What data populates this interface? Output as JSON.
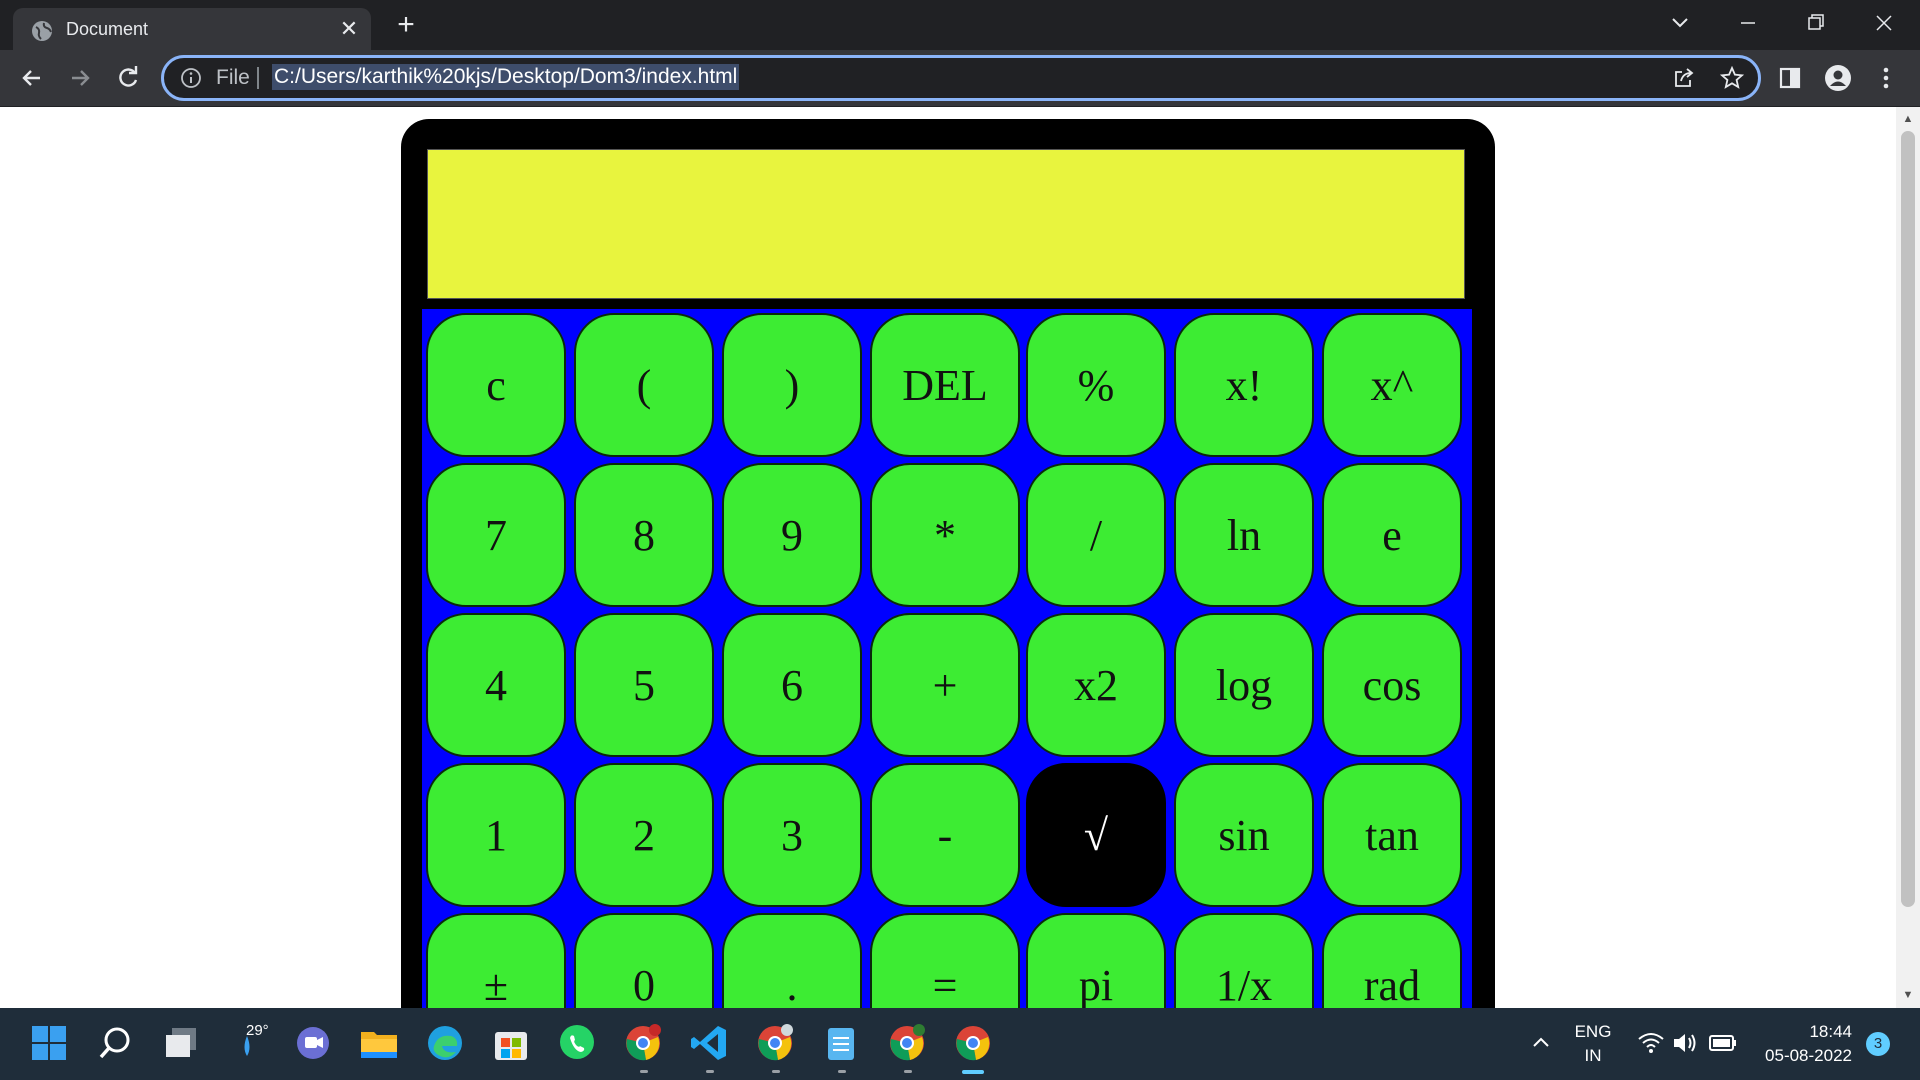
{
  "browser": {
    "tab_title": "Document",
    "new_tab_symbol": "+",
    "tab_close_symbol": "✕",
    "address_prefix": "File",
    "url": "C:/Users/karthik%20kjs/Desktop/Dom3/index.html",
    "accent_color": "#8ab4f8"
  },
  "calculator": {
    "display_value": "",
    "display_color": "#e8f43e",
    "keypad_color": "#0000ff",
    "key_color": "#3dec33",
    "active_key": "√",
    "rows": [
      [
        "c",
        "(",
        ")",
        "DEL",
        "%",
        "x!",
        "x^"
      ],
      [
        "7",
        "8",
        "9",
        "*",
        "/",
        "ln",
        "e"
      ],
      [
        "4",
        "5",
        "6",
        "+",
        "x2",
        "log",
        "cos"
      ],
      [
        "1",
        "2",
        "3",
        "-",
        "√",
        "sin",
        "tan"
      ],
      [
        "±",
        "0",
        ".",
        "=",
        "pi",
        "1/x",
        "rad"
      ]
    ]
  },
  "taskbar": {
    "weather_temp": "29°",
    "language_line1": "ENG",
    "language_line2": "IN",
    "time": "18:44",
    "date": "05-08-2022",
    "notification_count": "3"
  }
}
